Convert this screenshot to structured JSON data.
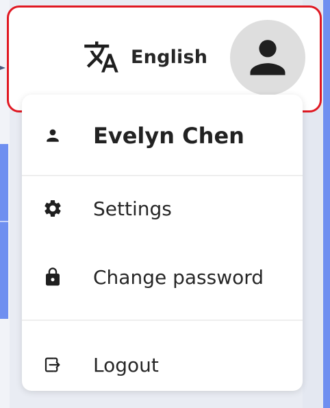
{
  "header": {
    "language_label": "English",
    "language_icon": "translate-icon",
    "avatar_icon": "person-icon",
    "highlight_color": "#e01822"
  },
  "menu": {
    "user_name": "Evelyn Chen",
    "items": [
      {
        "label": "Settings",
        "icon": "gear-icon"
      },
      {
        "label": "Change password",
        "icon": "lock-icon"
      },
      {
        "label": "Logout",
        "icon": "logout-icon"
      }
    ]
  },
  "colors": {
    "accent_blue": "#6f8ff0",
    "background": "#e9ecf3"
  }
}
